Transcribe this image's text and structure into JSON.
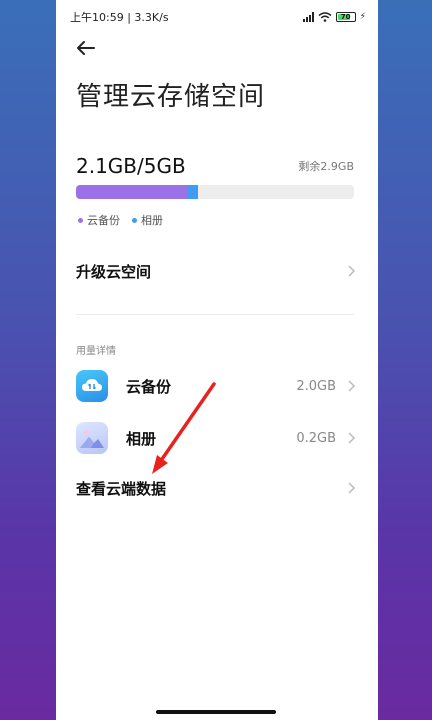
{
  "status_bar": {
    "time": "上午10:59",
    "speed": "3.3K/s",
    "battery": "70"
  },
  "page": {
    "title": "管理云存储空间"
  },
  "storage": {
    "usage": "2.1GB/5GB",
    "remaining": "剩余2.9GB",
    "backup_fraction": 0.4,
    "album_fraction": 0.04,
    "colors": {
      "backup": "#9b71e8",
      "album": "#3f9cf0",
      "track": "#ededed"
    }
  },
  "legend": [
    {
      "label": "云备份",
      "color": "#9b71e8"
    },
    {
      "label": "相册",
      "color": "#3f9cf0"
    }
  ],
  "upgrade": {
    "label": "升级云空间"
  },
  "details": {
    "section_label": "用量详情",
    "items": [
      {
        "name": "云备份",
        "size": "2.0GB",
        "icon": "cloud-backup-icon"
      },
      {
        "name": "相册",
        "size": "0.2GB",
        "icon": "album-icon"
      }
    ]
  },
  "view_cloud": {
    "label": "查看云端数据"
  },
  "annotation": {
    "arrow_color": "#e8231f"
  }
}
